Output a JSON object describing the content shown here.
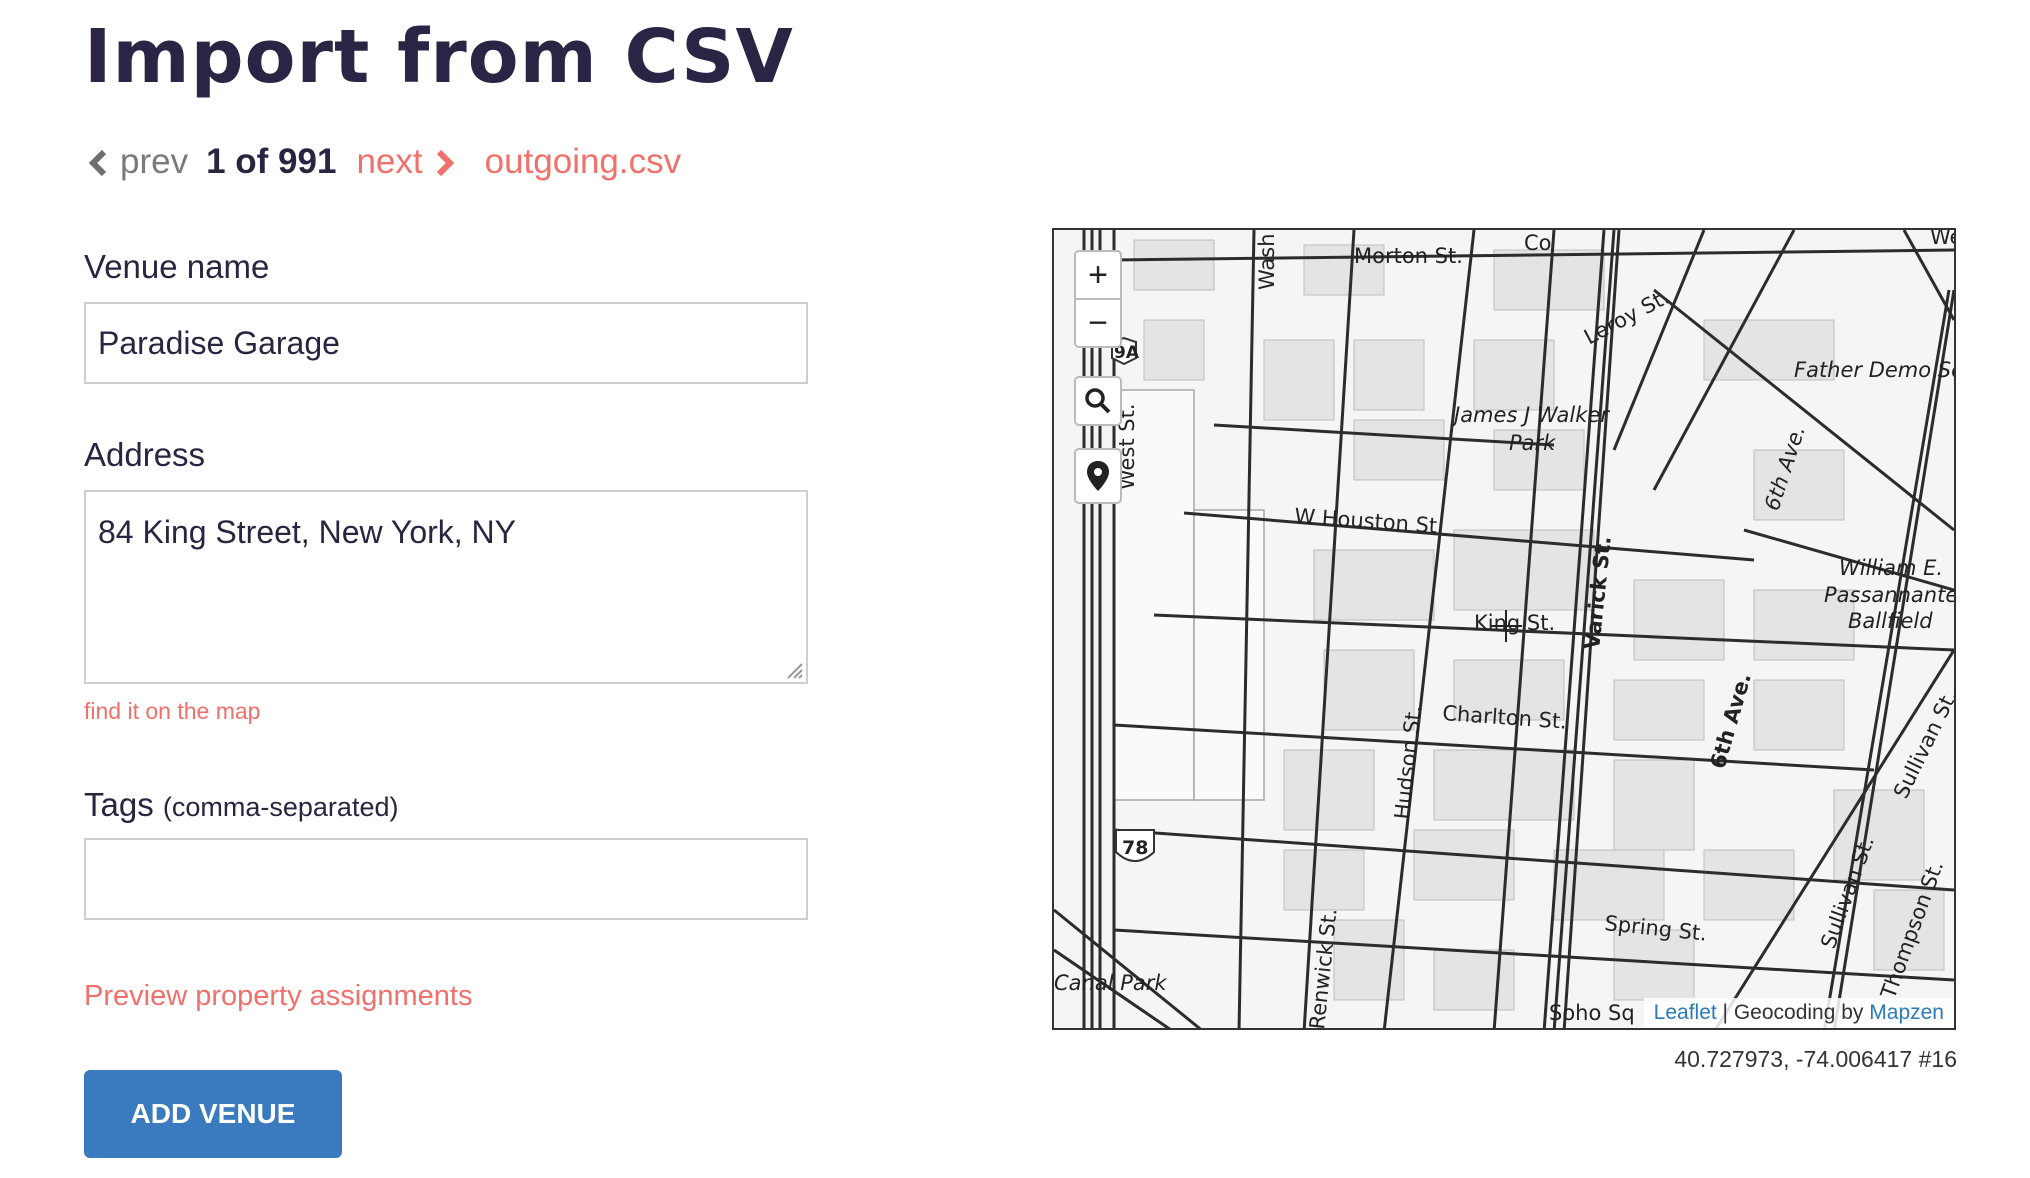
{
  "page": {
    "title": "Import from CSV"
  },
  "pager": {
    "prev_label": "prev",
    "count_label": "1 of 991",
    "next_label": "next",
    "file_name": "outgoing.csv"
  },
  "form": {
    "venue_name": {
      "label": "Venue name",
      "value": "Paradise Garage"
    },
    "address": {
      "label": "Address",
      "value": "84 King Street, New York, NY",
      "find_link": "find it on the map"
    },
    "tags": {
      "label": "Tags",
      "label_note": "(comma-separated)",
      "value": ""
    },
    "preview_link": "Preview property assignments",
    "submit_label": "ADD VENUE"
  },
  "map": {
    "zoom_in_label": "+",
    "zoom_out_label": "−",
    "search_icon": "search-icon",
    "locate_icon": "map-pin-icon",
    "attribution": {
      "leaflet": "Leaflet",
      "separator": " | Geocoding by ",
      "provider": "Mapzen"
    },
    "coords_readout": "40.727973, -74.006417 #16",
    "street_labels": {
      "morton": "Morton St.",
      "leroy": "Leroy St.",
      "father_demo": "Father Demo Sq",
      "james_walker_1": "James J Walker",
      "james_walker_2": "Park",
      "w_houston": "W Houston St.",
      "varick": "Varick St.",
      "king": "King St.",
      "charlton": "Charlton St.",
      "hudson": "Hudson St.",
      "sixth_ave_1": "6th Ave.",
      "sixth_ave_2": "6th Ave.",
      "passannante_1": "William E.",
      "passannante_2": "Passannante",
      "passannante_3": "Ballfield",
      "sullivan_1": "Sullivan St.",
      "sullivan_2": "Sullivan St.",
      "thompson": "Thompson St.",
      "spring": "Spring St.",
      "canal_park": "Canal Park",
      "renwick": "Renwick St.",
      "soho_sq": "Soho Sq",
      "west_st": "West St.",
      "wash": "Wash",
      "corner_top": "Co",
      "corner_right": "We",
      "shield_9a": "9A",
      "shield_78": "78"
    }
  },
  "colors": {
    "accent": "#f0706c",
    "button": "#3a7bc0",
    "title": "#2b2444"
  }
}
